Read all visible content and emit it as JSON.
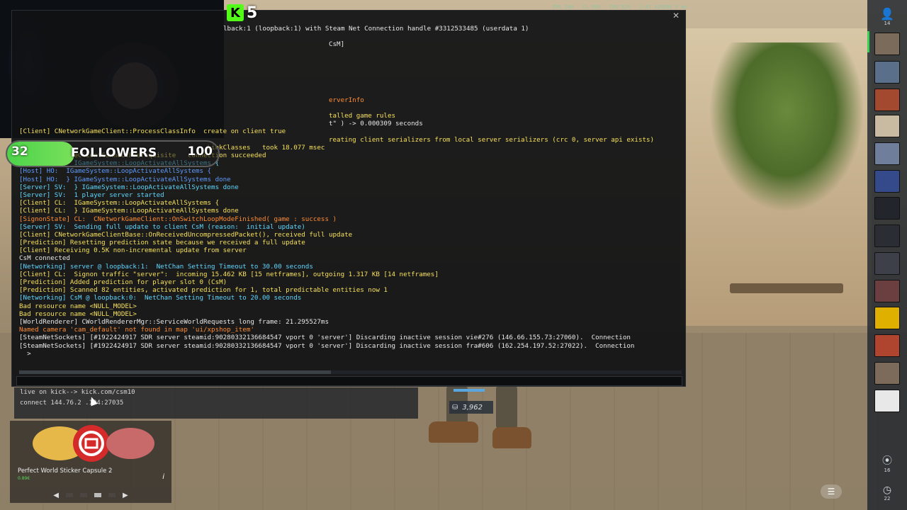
{
  "stream": {
    "kick_count": "5",
    "followers": {
      "current": "32",
      "title": "FOLLOWERS",
      "goal": "100",
      "progress": 0.32
    }
  },
  "console": {
    "header_line": "lback:1 (loopback:1) with Steam Net Connection handle #3312533485 (userdata 1)",
    "lines": [
      {
        "text": "                                                                               ",
        "color": "white"
      },
      {
        "text": "                                                                               CsM]",
        "color": "white"
      },
      {
        "text": "",
        "color": "white"
      },
      {
        "text": "",
        "color": "white"
      },
      {
        "text": "",
        "color": "white"
      },
      {
        "text": "",
        "color": "white"
      },
      {
        "text": "",
        "color": "white"
      },
      {
        "text": "",
        "color": "white"
      },
      {
        "text": "                                                                               erverInfo",
        "color": "orange"
      },
      {
        "text": "",
        "color": "white"
      },
      {
        "text": "                                                                               talled game rules",
        "color": "yellow"
      },
      {
        "text": "                                                                               t\" ) -> 0.000309 seconds",
        "color": "white"
      },
      {
        "text": "[Client] CNetworkGameClient::ProcessClassInfo  create on client true",
        "color": "yellow"
      },
      {
        "text": "                                                                               reating client serializers from local server serializers (crc 0, server api exists)",
        "color": "yellow"
      },
      {
        "text": "                                                LinkClasses   took 18.077 msec",
        "color": "yellow"
      },
      {
        "text": "          CGameClientConnectPrerequisite   connection succeeded",
        "color": "yellow"
      },
      {
        "text": "[Server] SV:  IGameSystem::LoopActivateAllSystems {",
        "color": "cyan"
      },
      {
        "text": "[Host] HO:  IGameSystem::LoopActivateAllSystems {",
        "color": "blue"
      },
      {
        "text": "[Host] HO:  } IGameSystem::LoopActivateAllSystems done",
        "color": "blue"
      },
      {
        "text": "[Server] SV:  } IGameSystem::LoopActivateAllSystems done",
        "color": "cyan"
      },
      {
        "text": "[Server] SV:  1 player server started",
        "color": "cyan"
      },
      {
        "text": "[Client] CL:  IGameSystem::LoopActivateAllSystems {",
        "color": "yellow"
      },
      {
        "text": "[Client] CL:  } IGameSystem::LoopActivateAllSystems done",
        "color": "yellow"
      },
      {
        "text": "[SignonState] CL:  CNetworkGameClient::OnSwitchLoopModeFinished( game : success )",
        "color": "orange"
      },
      {
        "text": "[Server] SV:  Sending full update to client CsM (reason:  initial update)",
        "color": "cyan"
      },
      {
        "text": "[Client] CNetworkGameClientBase::OnReceivedUncompressedPacket(), received full update",
        "color": "yellow"
      },
      {
        "text": "[Prediction] Resetting prediction state because we received a full update",
        "color": "yellow"
      },
      {
        "text": "[Client] Receiving 0.5K non-incremental update from server",
        "color": "yellow"
      },
      {
        "text": "CsM connected",
        "color": "white"
      },
      {
        "text": "[Networking] server @ loopback:1:  NetChan Setting Timeout to 30.00 seconds",
        "color": "cyan"
      },
      {
        "text": "[Client] CL:  Signon traffic \"server\":  incoming 15.462 KB [15 netframes], outgoing 1.317 KB [14 netframes]",
        "color": "yellow"
      },
      {
        "text": "[Prediction] Added prediction for player slot 0 (CsM)",
        "color": "yellow"
      },
      {
        "text": "[Prediction] Scanned 82 entities, activated prediction for 1, total predictable entities now 1",
        "color": "yellow"
      },
      {
        "text": "[Networking] CsM @ loopback:0:  NetChan Setting Timeout to 20.00 seconds",
        "color": "cyan"
      },
      {
        "text": "Bad resource name <NULL_MODEL>",
        "color": "yellow"
      },
      {
        "text": "Bad resource name <NULL_MODEL>",
        "color": "yellow"
      },
      {
        "text": "[WorldRenderer] CWorldRendererMgr::ServiceWorldRequests long frame: 21.295527ms",
        "color": "white"
      },
      {
        "text": "Named camera 'cam_default' not found in map 'ui/xpshop_item'",
        "color": "orange"
      },
      {
        "text": "[SteamNetSockets] [#1922424917 SDR server steamid:90280332136684547 vport 0 'server'] Discarding inactive session vie#276 (146.66.155.73:27060).  Connection",
        "color": "white"
      },
      {
        "text": "[SteamNetSockets] [#1922424917 SDR server steamid:90280332136684547 vport 0 'server'] Discarding inactive session fra#606 (162.254.197.52:27022).  Connection",
        "color": "white"
      },
      {
        "text": "  >",
        "color": "white"
      }
    ],
    "input_value": ""
  },
  "history": {
    "item1": "live on kick--> kick.com/csm10",
    "item2": "connect 144.76.2 .194:27035"
  },
  "item_badge": {
    "value": "3,962"
  },
  "capsule": {
    "name": "Perfect World Sticker Capsule 2",
    "price": "0.89€",
    "info_icon": "i"
  },
  "sidebar": {
    "friends_count": "14",
    "bottom1_count": "16",
    "bottom2_count": "22"
  },
  "colors": {
    "accent_green": "#53fc18",
    "cyan": "#5fd7ff",
    "yellow": "#f6e05a",
    "orange": "#ff8c32"
  }
}
